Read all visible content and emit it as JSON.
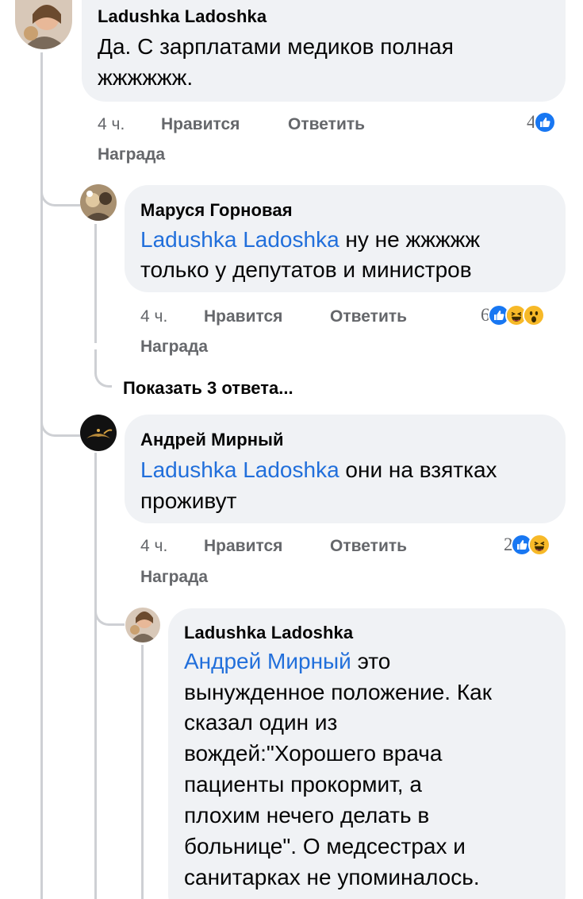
{
  "comments": [
    {
      "author": "Ladushka Ladoshka",
      "text": "Да. С зарплатами медиков полная жжжжжж.",
      "line1": "Да. С зарплатами медиков полная",
      "line2": "жжжжжж.",
      "time": "4 ч.",
      "like_label": "Нравится",
      "reply_label": "Ответить",
      "award_label": "Награда",
      "reaction_count": "4",
      "reactions": [
        "like-icon"
      ]
    },
    {
      "author": "Маруся Горновая",
      "mention": "Ladushka Ladoshka",
      "line1_rest": " ну не жжжжж",
      "line2": "только у депутатов и министров",
      "time": "4 ч.",
      "like_label": "Нравится",
      "reply_label": "Ответить",
      "award_label": "Награда",
      "reaction_count": "6",
      "reactions": [
        "like-icon",
        "haha-icon",
        "wow-icon"
      ]
    },
    {
      "author": "Андрей Мирный",
      "mention": "Ladushka Ladoshka",
      "line1_rest": " они на взятках",
      "line2": "проживут",
      "time": "4 ч.",
      "like_label": "Нравится",
      "reply_label": "Ответить",
      "award_label": "Награда",
      "reaction_count": "2",
      "reactions": [
        "like-icon",
        "haha-icon"
      ]
    },
    {
      "author": "Ladushka Ladoshka",
      "mention": "Андрей Мирный",
      "line1_rest": " это",
      "lines": [
        "вынужденное положение. Как",
        "сказал один из",
        "вождей:\"Хорошего врача",
        "пациенты прокормит, а",
        "плохим нечего делать в",
        "больнице\". О медсестрах и",
        "санитарках не упоминалось."
      ]
    }
  ],
  "show_replies_label": "Показать 3 ответа...",
  "colors": {
    "bubble": "#f0f2f5",
    "mention": "#216fdb",
    "meta": "#65676b",
    "like": "#1877f2",
    "haha": "#f7b928"
  }
}
